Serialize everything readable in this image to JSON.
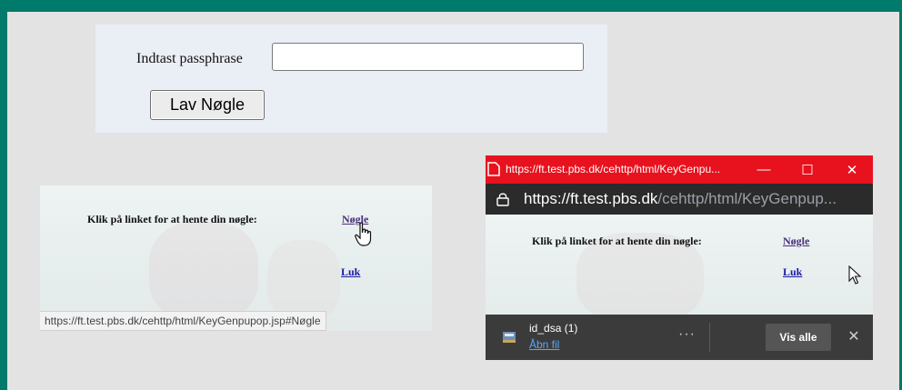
{
  "passphrase_form": {
    "label": "Indtast passphrase",
    "input_value": "",
    "button_label": "Lav Nøgle"
  },
  "link_page": {
    "instruction": "Klik på linket for at hente din nøgle:",
    "key_link": "Nøgle",
    "close_link": "Luk",
    "status_url": "https://ft.test.pbs.dk/cehttp/html/KeyGenpupop.jsp#Nøgle"
  },
  "popup_window": {
    "title": "https://ft.test.pbs.dk/cehttp/html/KeyGenpu...",
    "address_host": "https://ft.test.pbs.dk",
    "address_path": "/cehttp/html/KeyGenpup...",
    "instruction": "Klik på linket for at hente din nøgle:",
    "key_link": "Nøgle",
    "close_link": "Luk",
    "download": {
      "file_name": "id_dsa (1)",
      "open_label": "Åbn fil",
      "more_label": "···",
      "show_all_label": "Vis alle",
      "close_label": "✕"
    },
    "titlebar_buttons": {
      "minimize": "—",
      "maximize": "☐",
      "close": "✕"
    }
  },
  "colors": {
    "frame": "#007a6a",
    "titlebar": "#e8121e",
    "addressbar": "#2b2b2b",
    "download_bar": "#3b3b3b"
  }
}
